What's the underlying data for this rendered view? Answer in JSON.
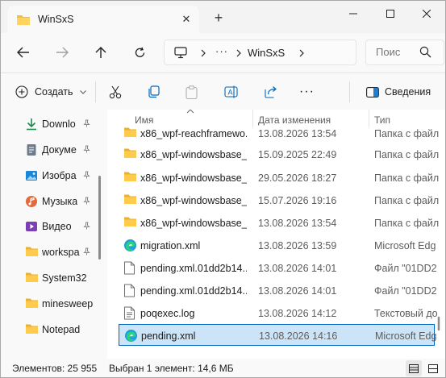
{
  "tab": {
    "title": "WinSxS",
    "close_glyph": "✕",
    "new_glyph": "+"
  },
  "window_controls": {
    "minimize": "minimize-icon",
    "maximize": "maximize-icon",
    "close": "close-icon"
  },
  "address": {
    "more": "···",
    "current": "WinSxS"
  },
  "search": {
    "placeholder": "Поис"
  },
  "toolbar": {
    "create_label": "Создать",
    "more_glyph": "···",
    "details_label": "Сведения"
  },
  "sidebar": {
    "items": [
      {
        "label": "Downlo",
        "icon": "download-icon",
        "pinned": true
      },
      {
        "label": "Докуме",
        "icon": "documents-icon",
        "pinned": true
      },
      {
        "label": "Изобра",
        "icon": "pictures-icon",
        "pinned": true
      },
      {
        "label": "Музыка",
        "icon": "music-icon",
        "pinned": true
      },
      {
        "label": "Видео",
        "icon": "videos-icon",
        "pinned": true
      },
      {
        "label": "workspa",
        "icon": "folder-icon",
        "pinned": true
      },
      {
        "label": "System32",
        "icon": "folder-icon",
        "pinned": false
      },
      {
        "label": "minesweep",
        "icon": "folder-icon",
        "pinned": false
      },
      {
        "label": "Notepad",
        "icon": "folder-icon",
        "pinned": false
      }
    ]
  },
  "columns": {
    "name": "Имя",
    "date": "Дата изменения",
    "type": "Тип"
  },
  "files": [
    {
      "name": "x86_wpf-reachframewo...",
      "date": "13.08.2026 13:54",
      "type": "Папка с файл",
      "icon": "folder-icon"
    },
    {
      "name": "x86_wpf-windowsbase_...",
      "date": "15.09.2025 22:49",
      "type": "Папка с файл",
      "icon": "folder-icon"
    },
    {
      "name": "x86_wpf-windowsbase_...",
      "date": "29.05.2026 18:27",
      "type": "Папка с файл",
      "icon": "folder-icon"
    },
    {
      "name": "x86_wpf-windowsbase_...",
      "date": "15.07.2026 19:16",
      "type": "Папка с файл",
      "icon": "folder-icon"
    },
    {
      "name": "x86_wpf-windowsbase_...",
      "date": "13.08.2026 13:54",
      "type": "Папка с файл",
      "icon": "folder-icon"
    },
    {
      "name": "migration.xml",
      "date": "13.08.2026 13:59",
      "type": "Microsoft Edg",
      "icon": "edge-icon"
    },
    {
      "name": "pending.xml.01dd2b14...",
      "date": "13.08.2026 14:01",
      "type": "Файл \"01DD2",
      "icon": "file-icon"
    },
    {
      "name": "pending.xml.01dd2b14...",
      "date": "13.08.2026 14:01",
      "type": "Файл \"01DD2",
      "icon": "file-icon"
    },
    {
      "name": "poqexec.log",
      "date": "13.08.2026 14:12",
      "type": "Текстовый до",
      "icon": "text-file-icon"
    },
    {
      "name": "pending.xml",
      "date": "13.08.2026 14:16",
      "type": "Microsoft Edg",
      "icon": "edge-icon",
      "selected": true
    }
  ],
  "status": {
    "items": "Элементов: 25 955",
    "selection": "Выбран 1 элемент: 14,6 МБ"
  }
}
